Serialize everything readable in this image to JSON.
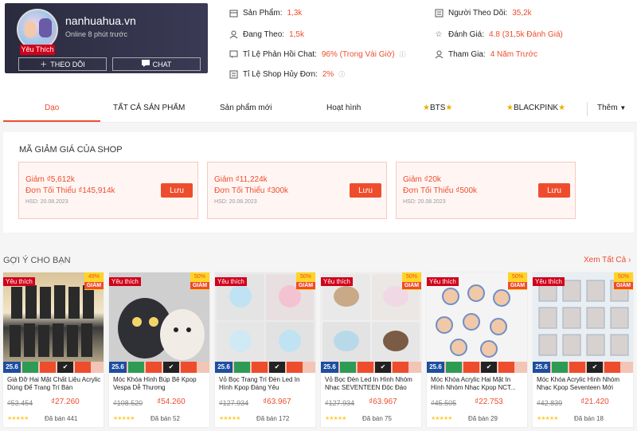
{
  "shop": {
    "name": "nanhuahua.vn",
    "online": "Online 8 phút trước",
    "badge": "Yêu Thích",
    "follow_label": "THEO DÕI",
    "chat_label": "CHAT"
  },
  "stats": {
    "products_label": "Sản Phẩm:",
    "products_value": "1,3k",
    "following_label": "Đang Theo:",
    "following_value": "1,5k",
    "chat_label": "Tỉ Lệ Phản Hồi Chat:",
    "chat_value": "96% (Trong Vài Giờ)",
    "cancel_label": "Tỉ Lệ Shop Hủy Đơn:",
    "cancel_value": "2%",
    "followers_label": "Người Theo Dõi:",
    "followers_value": "35,2k",
    "rating_label": "Đánh Giá:",
    "rating_value": "4.8 (31,5k Đánh Giá)",
    "joined_label": "Tham Gia:",
    "joined_value": "4 Năm Trước"
  },
  "tabs": [
    "Dạo",
    "TẤT CẢ SẢN PHẨM",
    "Sản phẩm mới",
    "Hoạt hình",
    "BTS",
    "BLACKPINK",
    "Thêm"
  ],
  "vouchers": {
    "title": "MÃ GIẢM GIÁ CỦA SHOP",
    "save_label": "Lưu",
    "items": [
      {
        "amount": "Giảm ₫5,612k",
        "min": "Đơn Tối Thiểu ₫145,914k",
        "hsd": "HSD: 20.08.2023"
      },
      {
        "amount": "Giảm ₫11,224k",
        "min": "Đơn Tối Thiểu ₫300k",
        "hsd": "HSD: 20.08.2023"
      },
      {
        "amount": "Giảm ₫20k",
        "min": "Đơn Tối Thiểu ₫500k",
        "hsd": "HSD: 20.08.2023"
      }
    ]
  },
  "suggest": {
    "title": "GỢI Ý CHO BẠN",
    "see_all": "Xem Tất Cả"
  },
  "products": [
    {
      "badge": "Yêu thích",
      "discount": "49%",
      "name": "Giá Đỡ Hai Mặt Chất Liệu Acrylic Dùng Để Trang Trí Bàn",
      "old": "₫53.454",
      "new": "₫27.260",
      "sold": "Đã bán 441",
      "promo": "25.6"
    },
    {
      "badge": "Yêu thích",
      "discount": "50%",
      "name": "Móc Khóa Hình Búp Bê Kpop Vespa Dễ Thương",
      "old": "₫108.520",
      "new": "₫54.260",
      "sold": "Đã bán 52",
      "promo": "25.6"
    },
    {
      "badge": "Yêu thích",
      "discount": "50%",
      "name": "Vỏ Bọc Trang Trí Đèn Led In Hình Kpop Đáng Yêu",
      "old": "₫127.934",
      "new": "₫63.967",
      "sold": "Đã bán 172",
      "promo": "25.6"
    },
    {
      "badge": "Yêu thích",
      "discount": "50%",
      "name": "Vỏ Bọc Đèn Led In Hình Nhóm Nhạc SEVENTEEN Độc Đáo",
      "old": "₫127.934",
      "new": "₫63.967",
      "sold": "Đã bán 75",
      "promo": "25.6"
    },
    {
      "badge": "Yêu thích",
      "discount": "50%",
      "name": "Móc Khóa Acrylic Hai Mặt In Hình Nhóm Nhạc Kpop NCT...",
      "old": "₫45.505",
      "new": "₫22.753",
      "sold": "Đã bán 29",
      "promo": "25.6"
    },
    {
      "badge": "Yêu thích",
      "discount": "50%",
      "name": "Móc Khóa Acrylic Hình Nhóm Nhạc Kpop Seventeen Mới",
      "old": "₫42.839",
      "new": "₫21.420",
      "sold": "Đã bán 18",
      "promo": "25.6"
    }
  ],
  "icons": {
    "follow": "plus-icon",
    "chat": "chat-bubble-icon",
    "products": "store-icon",
    "following": "user-icon",
    "chat_rate": "chat-icon",
    "cancel": "shop-icon",
    "followers": "users-icon",
    "rating": "star-icon",
    "joined": "user-plus-icon",
    "see_all": "chevron-right-icon",
    "more": "caret-down-icon"
  },
  "colors": {
    "accent": "#ee4d2d",
    "header_bg": "#2b2b3f",
    "badge_red": "#d0011b",
    "promo_blue": "#1d4ea0"
  }
}
